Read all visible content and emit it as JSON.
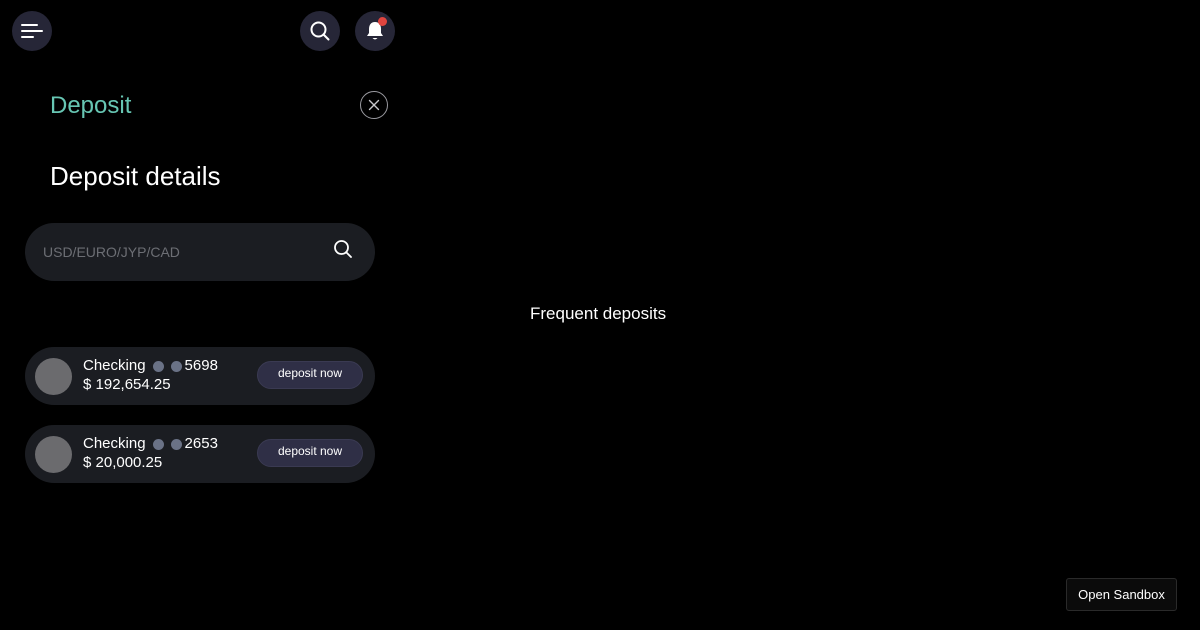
{
  "header": {
    "menu_icon": "menu-icon",
    "search_icon": "search-icon",
    "bell_icon": "bell-icon",
    "has_notification": true
  },
  "panel": {
    "title": "Deposit",
    "close_icon": "close-icon",
    "subtitle": "Deposit details",
    "search": {
      "placeholder": "USD/EURO/JYP/CAD",
      "value": "",
      "icon": "search-icon"
    },
    "accounts": [
      {
        "type": "Checking",
        "last4": "5698",
        "balance": "$ 192,654.25",
        "action_label": "deposit now"
      },
      {
        "type": "Checking",
        "last4": "2653",
        "balance": "$ 20,000.25",
        "action_label": "deposit now"
      }
    ]
  },
  "main": {
    "frequent_label": "Frequent deposits"
  },
  "footer": {
    "sandbox_label": "Open Sandbox"
  },
  "colors": {
    "background": "#000000",
    "accent": "#67c6b3",
    "card": "#1b1d22",
    "button": "#262637",
    "notification": "#e0453f"
  }
}
